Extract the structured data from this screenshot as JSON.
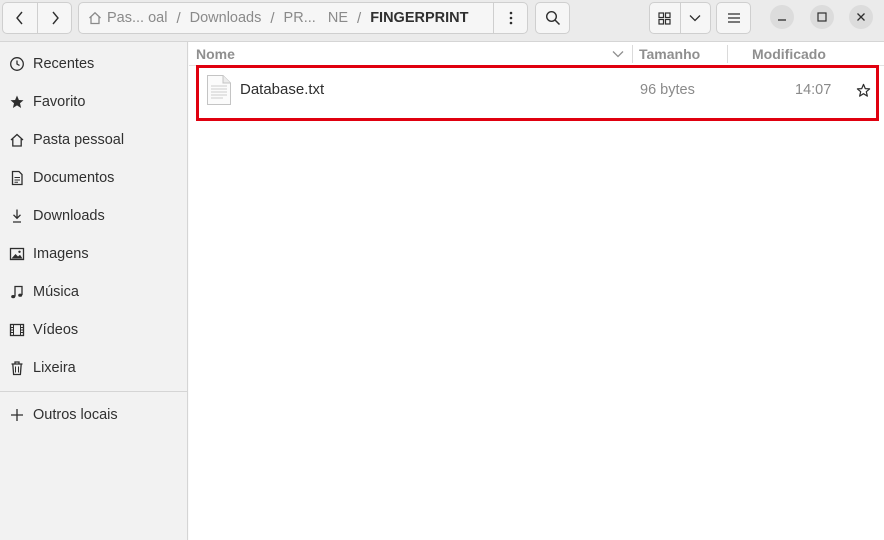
{
  "header": {
    "breadcrumb": [
      "Pas... oal",
      "Downloads",
      "PR...   NE"
    ],
    "current_folder": "FINGERPRINT",
    "separator": "/"
  },
  "sidebar": {
    "items": [
      {
        "label": "Recentes",
        "icon": "clock-icon"
      },
      {
        "label": "Favorito",
        "icon": "star-icon"
      },
      {
        "label": "Pasta pessoal",
        "icon": "home-icon"
      },
      {
        "label": "Documentos",
        "icon": "document-icon"
      },
      {
        "label": "Downloads",
        "icon": "download-icon"
      },
      {
        "label": "Imagens",
        "icon": "image-icon"
      },
      {
        "label": "Música",
        "icon": "music-icon"
      },
      {
        "label": "Vídeos",
        "icon": "video-icon"
      },
      {
        "label": "Lixeira",
        "icon": "trash-icon"
      }
    ],
    "other": {
      "label": "Outros locais",
      "icon": "plus-icon"
    }
  },
  "columns": {
    "name": "Nome",
    "size": "Tamanho",
    "modified": "Modificado"
  },
  "files": [
    {
      "name": "Database.txt",
      "size": "96 bytes",
      "modified": "14:07",
      "icon": "text-file-icon"
    }
  ],
  "colors": {
    "highlight": "#e0000f"
  }
}
